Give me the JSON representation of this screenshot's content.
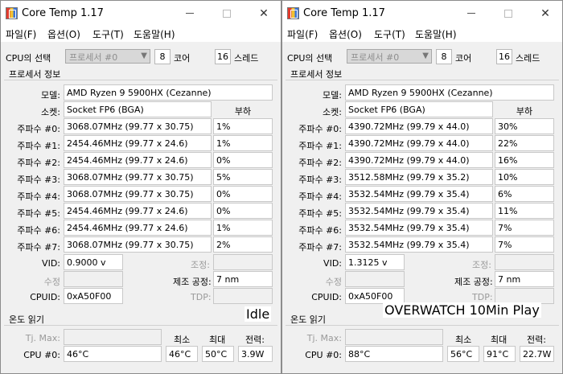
{
  "windows": [
    {
      "title": "Core Temp 1.17",
      "menu": [
        "파일(F)",
        "옵션(O)",
        "도구(T)",
        "도움말(H)"
      ],
      "cpu_select_label": "CPU의 선택",
      "cpu_select_value": "프로세서 #0",
      "cores_value": "8",
      "cores_label": "코어",
      "threads_value": "16",
      "threads_label": "스레드",
      "proc_info_title": "프로세서 정보",
      "model_label": "모델:",
      "model_value": "AMD Ryzen 9 5900HX (Cezanne)",
      "socket_label": "소켓:",
      "socket_value": "Socket FP6 (BGA)",
      "load_header": "부하",
      "freqs": [
        {
          "label": "주파수 #0:",
          "value": "3068.07MHz (99.77 x 30.75)",
          "load": "1%"
        },
        {
          "label": "주파수 #1:",
          "value": "2454.46MHz (99.77 x 24.6)",
          "load": "1%"
        },
        {
          "label": "주파수 #2:",
          "value": "2454.46MHz (99.77 x 24.6)",
          "load": "0%"
        },
        {
          "label": "주파수 #3:",
          "value": "3068.07MHz (99.77 x 30.75)",
          "load": "5%"
        },
        {
          "label": "주파수 #4:",
          "value": "3068.07MHz (99.77 x 30.75)",
          "load": "0%"
        },
        {
          "label": "주파수 #5:",
          "value": "2454.46MHz (99.77 x 24.6)",
          "load": "0%"
        },
        {
          "label": "주파수 #6:",
          "value": "2454.46MHz (99.77 x 24.6)",
          "load": "1%"
        },
        {
          "label": "주파수 #7:",
          "value": "3068.07MHz (99.77 x 30.75)",
          "load": "2%"
        }
      ],
      "vid_label": "VID:",
      "vid_value": "0.9000 v",
      "adjust_label": "조정:",
      "revision_label": "수정",
      "lithography_label": "제조 공정:",
      "lithography_value": "7 nm",
      "cpuid_label": "CPUID:",
      "cpuid_value": "0xA50F00",
      "tdp_label": "TDP:",
      "temp_title": "온도 읽기",
      "tjmax_label": "Tj. Max:",
      "min_label": "최소",
      "max_label": "최대",
      "power_label": "전력:",
      "cpu0_label": "CPU #0:",
      "cpu0_temp": "46°C",
      "cpu0_min": "46°C",
      "cpu0_max": "50°C",
      "cpu0_power": "3.9W"
    },
    {
      "title": "Core Temp 1.17",
      "menu": [
        "파일(F)",
        "옵션(O)",
        "도구(T)",
        "도움말(H)"
      ],
      "cpu_select_label": "CPU의 선택",
      "cpu_select_value": "프로세서 #0",
      "cores_value": "8",
      "cores_label": "코어",
      "threads_value": "16",
      "threads_label": "스레드",
      "proc_info_title": "프로세서 정보",
      "model_label": "모델:",
      "model_value": "AMD Ryzen 9 5900HX (Cezanne)",
      "socket_label": "소켓:",
      "socket_value": "Socket FP6 (BGA)",
      "load_header": "부하",
      "freqs": [
        {
          "label": "주파수 #0:",
          "value": "4390.72MHz (99.79 x 44.0)",
          "load": "30%"
        },
        {
          "label": "주파수 #1:",
          "value": "4390.72MHz (99.79 x 44.0)",
          "load": "22%"
        },
        {
          "label": "주파수 #2:",
          "value": "4390.72MHz (99.79 x 44.0)",
          "load": "16%"
        },
        {
          "label": "주파수 #3:",
          "value": "3512.58MHz (99.79 x 35.2)",
          "load": "10%"
        },
        {
          "label": "주파수 #4:",
          "value": "3532.54MHz (99.79 x 35.4)",
          "load": "6%"
        },
        {
          "label": "주파수 #5:",
          "value": "3532.54MHz (99.79 x 35.4)",
          "load": "11%"
        },
        {
          "label": "주파수 #6:",
          "value": "3532.54MHz (99.79 x 35.4)",
          "load": "7%"
        },
        {
          "label": "주파수 #7:",
          "value": "3532.54MHz (99.79 x 35.4)",
          "load": "7%"
        }
      ],
      "vid_label": "VID:",
      "vid_value": "1.3125 v",
      "adjust_label": "조정:",
      "revision_label": "수정",
      "lithography_label": "제조 공정:",
      "lithography_value": "7 nm",
      "cpuid_label": "CPUID:",
      "cpuid_value": "0xA50F00",
      "tdp_label": "TDP:",
      "temp_title": "온도 읽기",
      "tjmax_label": "Tj. Max:",
      "min_label": "최소",
      "max_label": "최대",
      "power_label": "전력:",
      "cpu0_label": "CPU #0:",
      "cpu0_temp": "88°C",
      "cpu0_min": "56°C",
      "cpu0_max": "91°C",
      "cpu0_power": "22.7W"
    }
  ],
  "overlay_left": "Idle",
  "overlay_right": "OVERWATCH 10Min Play"
}
